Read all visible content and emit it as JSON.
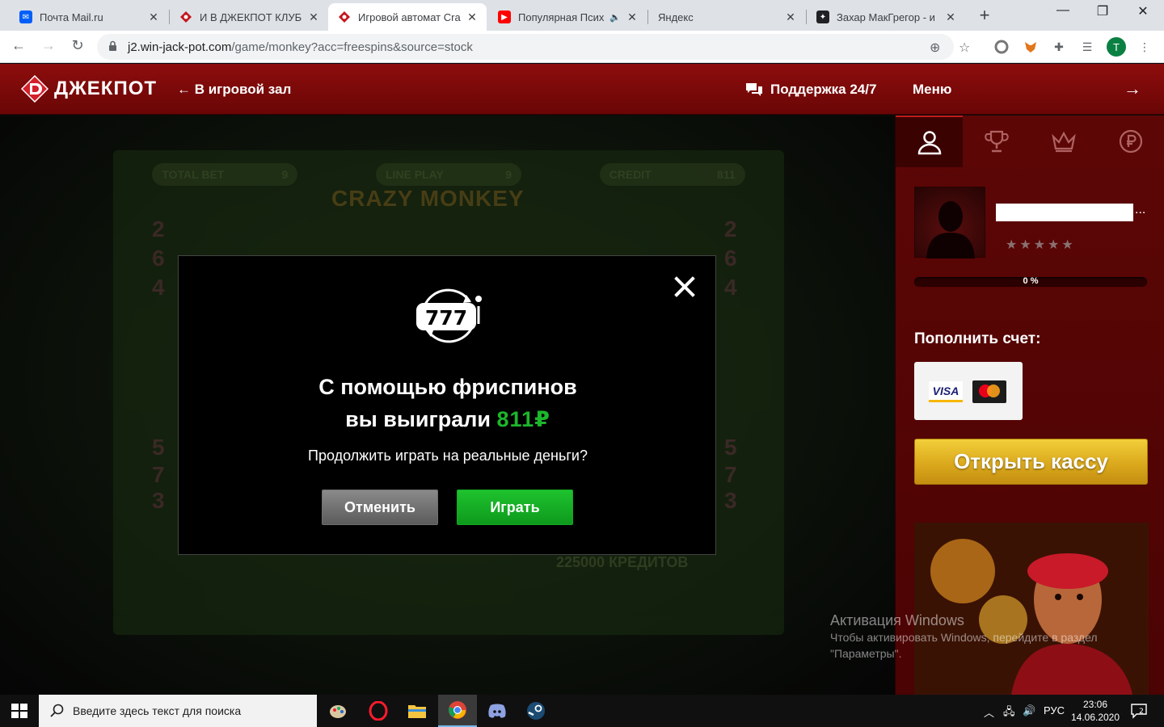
{
  "browser": {
    "tabs": [
      {
        "title": "Почта Mail.ru",
        "icon": "mail-icon"
      },
      {
        "title": "И В ДЖЕКПОТ КЛУБЕ",
        "icon": "jackpot-icon"
      },
      {
        "title": "Игровой автомат Crazy",
        "icon": "jackpot-icon"
      },
      {
        "title": "Популярная Псих",
        "icon": "youtube-icon"
      },
      {
        "title": "Яндекс",
        "icon": ""
      },
      {
        "title": "Захар МакГрегор - и",
        "icon": "dark-icon"
      }
    ],
    "url_host": "j2.win-jack-pot.com",
    "url_path": "/game/monkey?acc=freespins&source=stock",
    "profile_initial": "T"
  },
  "site": {
    "logo_text": "ДЖЕКПОТ",
    "back_link": "← В игровой зал",
    "support": "Поддержка 24/7",
    "menu": "Меню"
  },
  "game": {
    "pills": [
      {
        "label": "TOTAL BET",
        "value": "9"
      },
      {
        "label": "LINE PLAY",
        "value": "9"
      },
      {
        "label": "CREDIT",
        "value": "811"
      }
    ],
    "title": "CRAZY MONKEY",
    "credits_line": "225000 КРЕДИТОВ"
  },
  "modal": {
    "title_line1": "С помощью фриспинов",
    "title_line2_prefix": "вы выиграли",
    "amount": "811₽",
    "question": "Продолжить играть на реальные деньги?",
    "cancel_label": "Отменить",
    "play_label": "Играть"
  },
  "sidebar": {
    "progress_label": "0 %",
    "progress_fraction": 0,
    "deposit_title": "Пополнить счет:",
    "visa_label": "VISA",
    "cashier_label": "Открыть кассу",
    "username_suffix": "..."
  },
  "watermark": {
    "title": "Активация Windows",
    "line1": "Чтобы активировать Windows, перейдите в раздел",
    "line2": "\"Параметры\"."
  },
  "taskbar": {
    "search_placeholder": "Введите здесь текст для поиска",
    "lang": "РУС",
    "time": "23:06",
    "date": "14.06.2020",
    "notifications": "2"
  },
  "colors": {
    "header_red": "#8e0d0d",
    "sidebar_red": "#5d0606",
    "win_green": "#1db52c",
    "cashier_gold": "#dba91d"
  }
}
